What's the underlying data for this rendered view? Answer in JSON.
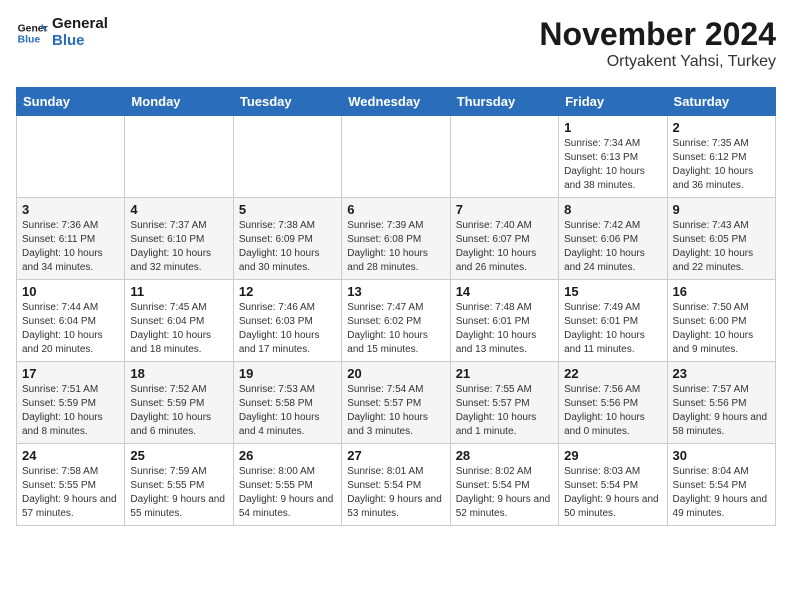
{
  "header": {
    "logo_line1": "General",
    "logo_line2": "Blue",
    "month_title": "November 2024",
    "location": "Ortyakent Yahsi, Turkey"
  },
  "weekdays": [
    "Sunday",
    "Monday",
    "Tuesday",
    "Wednesday",
    "Thursday",
    "Friday",
    "Saturday"
  ],
  "weeks": [
    [
      {
        "day": "",
        "info": ""
      },
      {
        "day": "",
        "info": ""
      },
      {
        "day": "",
        "info": ""
      },
      {
        "day": "",
        "info": ""
      },
      {
        "day": "",
        "info": ""
      },
      {
        "day": "1",
        "info": "Sunrise: 7:34 AM\nSunset: 6:13 PM\nDaylight: 10 hours and 38 minutes."
      },
      {
        "day": "2",
        "info": "Sunrise: 7:35 AM\nSunset: 6:12 PM\nDaylight: 10 hours and 36 minutes."
      }
    ],
    [
      {
        "day": "3",
        "info": "Sunrise: 7:36 AM\nSunset: 6:11 PM\nDaylight: 10 hours and 34 minutes."
      },
      {
        "day": "4",
        "info": "Sunrise: 7:37 AM\nSunset: 6:10 PM\nDaylight: 10 hours and 32 minutes."
      },
      {
        "day": "5",
        "info": "Sunrise: 7:38 AM\nSunset: 6:09 PM\nDaylight: 10 hours and 30 minutes."
      },
      {
        "day": "6",
        "info": "Sunrise: 7:39 AM\nSunset: 6:08 PM\nDaylight: 10 hours and 28 minutes."
      },
      {
        "day": "7",
        "info": "Sunrise: 7:40 AM\nSunset: 6:07 PM\nDaylight: 10 hours and 26 minutes."
      },
      {
        "day": "8",
        "info": "Sunrise: 7:42 AM\nSunset: 6:06 PM\nDaylight: 10 hours and 24 minutes."
      },
      {
        "day": "9",
        "info": "Sunrise: 7:43 AM\nSunset: 6:05 PM\nDaylight: 10 hours and 22 minutes."
      }
    ],
    [
      {
        "day": "10",
        "info": "Sunrise: 7:44 AM\nSunset: 6:04 PM\nDaylight: 10 hours and 20 minutes."
      },
      {
        "day": "11",
        "info": "Sunrise: 7:45 AM\nSunset: 6:04 PM\nDaylight: 10 hours and 18 minutes."
      },
      {
        "day": "12",
        "info": "Sunrise: 7:46 AM\nSunset: 6:03 PM\nDaylight: 10 hours and 17 minutes."
      },
      {
        "day": "13",
        "info": "Sunrise: 7:47 AM\nSunset: 6:02 PM\nDaylight: 10 hours and 15 minutes."
      },
      {
        "day": "14",
        "info": "Sunrise: 7:48 AM\nSunset: 6:01 PM\nDaylight: 10 hours and 13 minutes."
      },
      {
        "day": "15",
        "info": "Sunrise: 7:49 AM\nSunset: 6:01 PM\nDaylight: 10 hours and 11 minutes."
      },
      {
        "day": "16",
        "info": "Sunrise: 7:50 AM\nSunset: 6:00 PM\nDaylight: 10 hours and 9 minutes."
      }
    ],
    [
      {
        "day": "17",
        "info": "Sunrise: 7:51 AM\nSunset: 5:59 PM\nDaylight: 10 hours and 8 minutes."
      },
      {
        "day": "18",
        "info": "Sunrise: 7:52 AM\nSunset: 5:59 PM\nDaylight: 10 hours and 6 minutes."
      },
      {
        "day": "19",
        "info": "Sunrise: 7:53 AM\nSunset: 5:58 PM\nDaylight: 10 hours and 4 minutes."
      },
      {
        "day": "20",
        "info": "Sunrise: 7:54 AM\nSunset: 5:57 PM\nDaylight: 10 hours and 3 minutes."
      },
      {
        "day": "21",
        "info": "Sunrise: 7:55 AM\nSunset: 5:57 PM\nDaylight: 10 hours and 1 minute."
      },
      {
        "day": "22",
        "info": "Sunrise: 7:56 AM\nSunset: 5:56 PM\nDaylight: 10 hours and 0 minutes."
      },
      {
        "day": "23",
        "info": "Sunrise: 7:57 AM\nSunset: 5:56 PM\nDaylight: 9 hours and 58 minutes."
      }
    ],
    [
      {
        "day": "24",
        "info": "Sunrise: 7:58 AM\nSunset: 5:55 PM\nDaylight: 9 hours and 57 minutes."
      },
      {
        "day": "25",
        "info": "Sunrise: 7:59 AM\nSunset: 5:55 PM\nDaylight: 9 hours and 55 minutes."
      },
      {
        "day": "26",
        "info": "Sunrise: 8:00 AM\nSunset: 5:55 PM\nDaylight: 9 hours and 54 minutes."
      },
      {
        "day": "27",
        "info": "Sunrise: 8:01 AM\nSunset: 5:54 PM\nDaylight: 9 hours and 53 minutes."
      },
      {
        "day": "28",
        "info": "Sunrise: 8:02 AM\nSunset: 5:54 PM\nDaylight: 9 hours and 52 minutes."
      },
      {
        "day": "29",
        "info": "Sunrise: 8:03 AM\nSunset: 5:54 PM\nDaylight: 9 hours and 50 minutes."
      },
      {
        "day": "30",
        "info": "Sunrise: 8:04 AM\nSunset: 5:54 PM\nDaylight: 9 hours and 49 minutes."
      }
    ]
  ]
}
